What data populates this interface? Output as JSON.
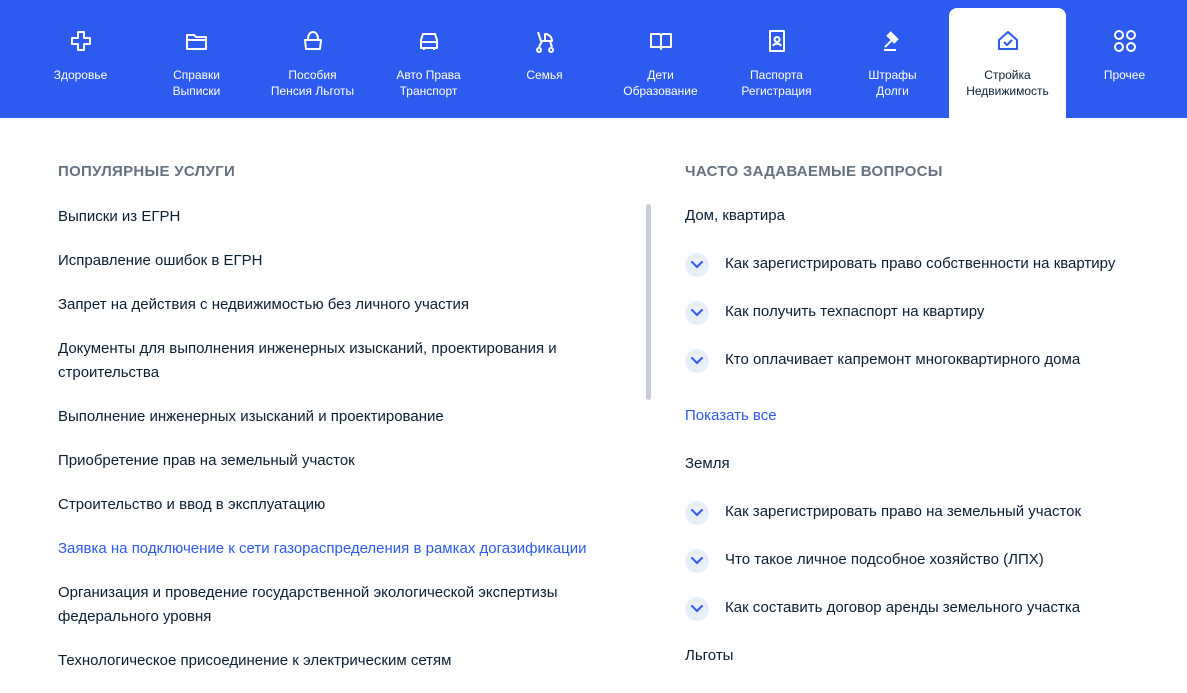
{
  "categories": [
    {
      "label_1": "Здоровье",
      "label_2": "",
      "icon": "health-cross-icon"
    },
    {
      "label_1": "Справки",
      "label_2": "Выписки",
      "icon": "folder-icon"
    },
    {
      "label_1": "Пособия",
      "label_2": "Пенсия Льготы",
      "icon": "wallet-bag-icon"
    },
    {
      "label_1": "Авто Права",
      "label_2": "Транспорт",
      "icon": "car-icon"
    },
    {
      "label_1": "Семья",
      "label_2": "",
      "icon": "stroller-icon"
    },
    {
      "label_1": "Дети",
      "label_2": "Образование",
      "icon": "book-icon"
    },
    {
      "label_1": "Паспорта",
      "label_2": "Регистрация",
      "icon": "passport-icon"
    },
    {
      "label_1": "Штрафы",
      "label_2": "Долги",
      "icon": "gavel-icon"
    },
    {
      "label_1": "Стройка",
      "label_2": "Недвижимость",
      "icon": "house-icon",
      "active": true
    },
    {
      "label_1": "Прочее",
      "label_2": "",
      "icon": "grid-icon"
    }
  ],
  "popular": {
    "title": "ПОПУЛЯРНЫЕ УСЛУГИ",
    "items": [
      "Выписки из ЕГРН",
      "Исправление ошибок в ЕГРН",
      "Запрет на действия с недвижимостью без личного участия",
      "Документы для выполнения инженерных изысканий, проектирования и строительства",
      "Выполнение инженерных изысканий и проектирование",
      "Приобретение прав на земельный участок",
      "Строительство и ввод в эксплуатацию",
      "Заявка на подключение к сети газораспределения в рамках догазификации",
      "Организация и проведение государственной экологической экспертизы федерального уровня",
      "Технологическое присоединение к электрическим сетям"
    ]
  },
  "faq": {
    "title": "ЧАСТО ЗАДАВАЕМЫЕ ВОПРОСЫ",
    "groups": [
      {
        "name": "Дом, квартира",
        "questions": [
          "Как зарегистрировать право собственности на квартиру",
          "Как получить техпаспорт на квартиру",
          "Кто оплачивает капремонт многоквартирного дома"
        ],
        "show_all": "Показать все"
      },
      {
        "name": "Земля",
        "questions": [
          "Как зарегистрировать право на земельный участок",
          "Что такое личное подсобное хозяйство (ЛПХ)",
          "Как составить договор аренды земельного участка"
        ]
      },
      {
        "name": "Льготы",
        "questions": []
      }
    ]
  },
  "colors": {
    "brand_blue": "#2d5bf0",
    "text": "#0b1f33",
    "muted": "#66727f",
    "chevron_bg": "#e8eef8"
  }
}
